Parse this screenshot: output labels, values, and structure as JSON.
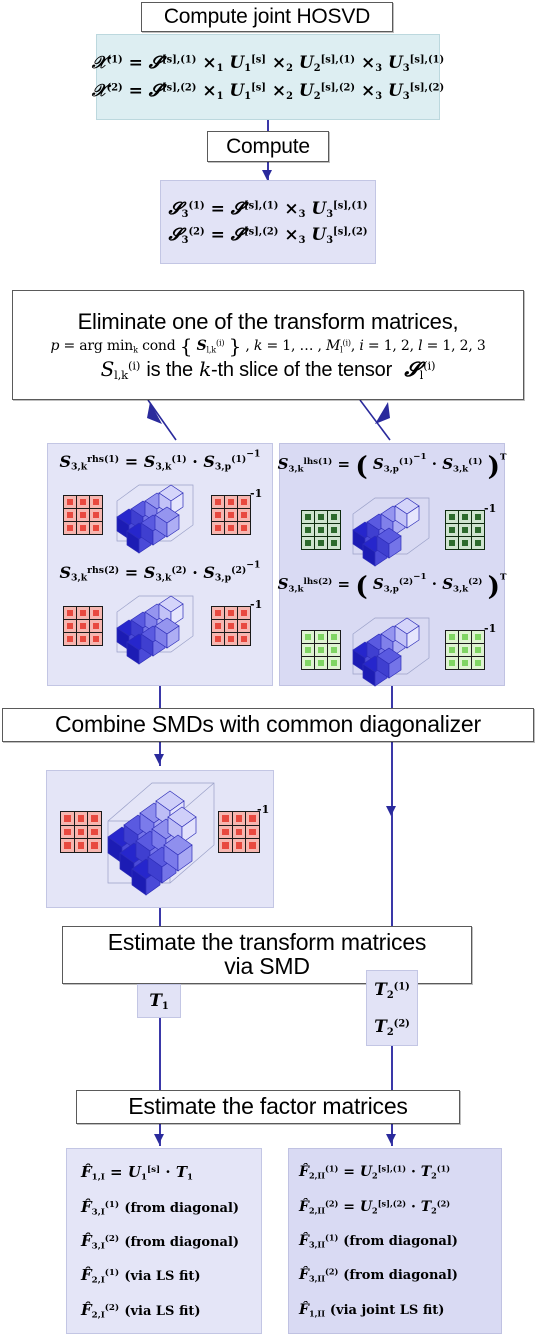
{
  "title": "Joint HOSVD / SMD tensor factorization flowchart",
  "steps": {
    "compute_joint_hosvd": "Compute joint HOSVD",
    "compute": "Compute",
    "eliminate_line1": "Eliminate one of the transform matrices,",
    "eliminate_line2": "p = arg min_k cond { S_{l,k}^{(i)} } , k = 1, … , M_l^{(i)}, i = 1, 2, l = 1, 2, 3",
    "eliminate_line3": "S_{l,k}^{(i)} is the k-th slice of the tensor  S_l^{(i)}",
    "combine": "Combine SMDs with common diagonalizer",
    "estimate_transform_l1": "Estimate the transform matrices",
    "estimate_transform_l2": "via SMD",
    "estimate_factor": "Estimate the factor matrices"
  },
  "hosvd_box": {
    "eq1": "X^(1) = S^[s],(1) ×1 U_1^[s] ×2 U_2^[s],(1) ×3 U_3^[s],(1)",
    "eq2": "X^(2) = S^[s],(2) ×1 U_1^[s] ×2 U_2^[s],(2) ×3 U_3^[s],(2)"
  },
  "core_box": {
    "eq1": "S_3^(1) = S^[s],(1) ×3 U_3^[s],(1)",
    "eq2": "S_3^(2) = S^[s],(2) ×3 U_3^[s],(2)"
  },
  "rhs_box": {
    "eq1": "S_{3,k}^rhs(1) = S_{3,k}^(1) · S_{3,p}^(1)^-1",
    "eq2": "S_{3,k}^rhs(2) = S_{3,k}^(2) · S_{3,p}^(2)^-1",
    "inverse_label": "-1"
  },
  "lhs_box": {
    "eq1": "S_{3,k}^lhs(1) = ( S_{3,p}^(1)^-1 · S_{3,k}^(1) )^T",
    "eq2": "S_{3,k}^lhs(2) = ( S_{3,p}^(2)^-1 · S_{3,k}^(2) )^T",
    "inverse_label": "-1"
  },
  "combined_box": {
    "inverse_label": "-1"
  },
  "t1_box": {
    "label": "T_1"
  },
  "t2_box": {
    "label1": "T_2^(1)",
    "label2": "T_2^(2)"
  },
  "factor_left": {
    "l1": "F̂_{1,I} = U_1^[s] · T_1",
    "l2": "F̂_{3,I}^(1)  (from diagonal)",
    "l3": "F̂_{3,I}^(2)  (from diagonal)",
    "l4": "F̂_{2,I}^(1)  (via LS fit)",
    "l5": "F̂_{2,I}^(2)  (via LS fit)",
    "note_diag": "(from diagonal)",
    "note_ls": "(via LS fit)"
  },
  "factor_right": {
    "l1": "F̂_{2,II}^(1) = U_2^[s],(1) · T_2^(1)",
    "l2": "F̂_{2,II}^(2) = U_2^[s],(2) · T_2^(2)",
    "l3": "F̂_{3,II}^(1)  (from diagonal)",
    "l4": "F̂_{3,II}^(2)  (from diagonal)",
    "l5": "F̂_{1,II}  (via joint LS fit)",
    "note_diag": "(from diagonal)",
    "note_joint_ls": "(via joint LS fit)"
  },
  "colors": {
    "arrow": "#2a2a9c",
    "proc_border": "#5a5a5a",
    "data_cyan": "#ddeef2",
    "data_lavender": "#e2e3f6",
    "data_lavender_dark": "#d9daf3",
    "matrix_red": "#e8493f",
    "matrix_dark_green": "#2d6b2d",
    "matrix_light_green": "#7fd463",
    "tensor_blue": "#2222cc"
  }
}
